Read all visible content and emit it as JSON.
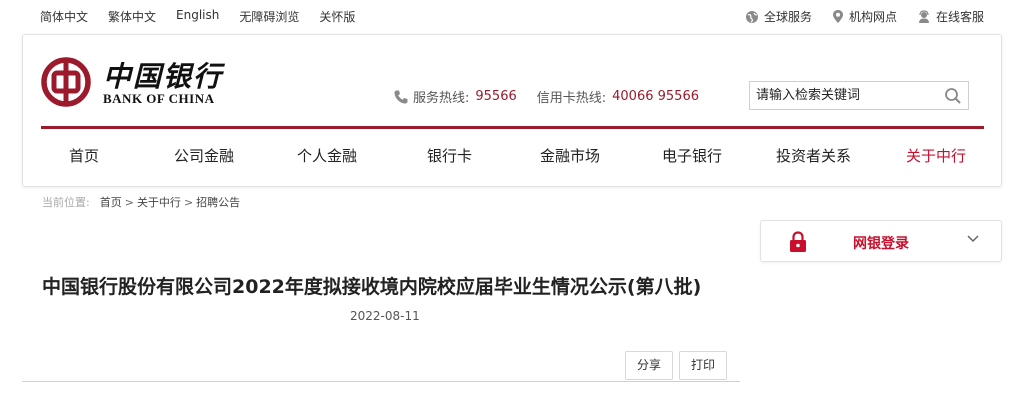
{
  "topbar": {
    "languages": [
      "简体中文",
      "繁体中文",
      "English",
      "无障碍浏览",
      "关怀版"
    ],
    "utilities": [
      {
        "label": "全球服务",
        "icon": "globe-icon"
      },
      {
        "label": "机构网点",
        "icon": "location-pin-icon"
      },
      {
        "label": "在线客服",
        "icon": "customer-service-icon"
      }
    ]
  },
  "header": {
    "logo_cn": "中国银行",
    "logo_en": "BANK OF CHINA",
    "service_hotline_label": "服务热线:",
    "service_hotline_number": "95566",
    "card_hotline_label": "信用卡热线:",
    "card_hotline_number": "40066 95566",
    "search_placeholder": "请输入检索关键词"
  },
  "nav": {
    "items": [
      "首页",
      "公司金融",
      "个人金融",
      "银行卡",
      "金融市场",
      "电子银行",
      "投资者关系",
      "关于中行"
    ],
    "active_index": 7
  },
  "breadcrumb": {
    "label": "当前位置:",
    "items": [
      "首页",
      "关于中行",
      "招聘公告"
    ],
    "separator": ">"
  },
  "login": {
    "label": "网银登录"
  },
  "article": {
    "title": "中国银行股份有限公司2022年度拟接收境内院校应届毕业生情况公示(第八批)",
    "date": "2022-08-11",
    "share_label": "分享",
    "print_label": "打印"
  },
  "colors": {
    "brand_red": "#9b1a2c",
    "active_red": "#c8102e"
  }
}
